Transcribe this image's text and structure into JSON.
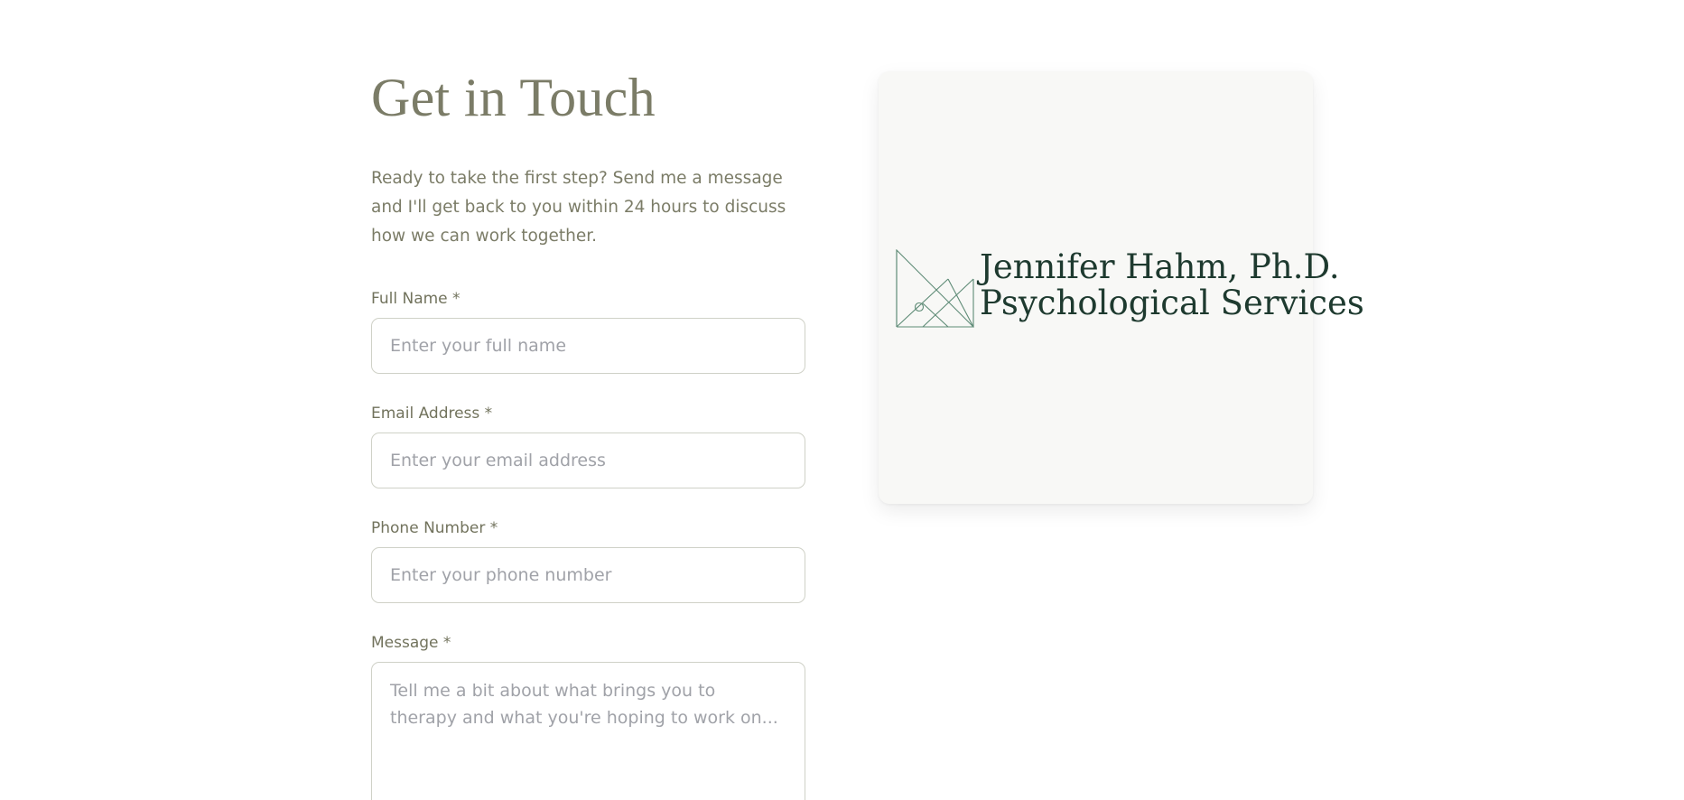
{
  "contact": {
    "title": "Get in Touch",
    "intro": "Ready to take the first step? Send me a message and I'll get back to you within 24 hours to discuss how we can work together."
  },
  "form": {
    "full_name": {
      "label": "Full Name *",
      "placeholder": "Enter your full name"
    },
    "email": {
      "label": "Email Address *",
      "placeholder": "Enter your email address"
    },
    "phone": {
      "label": "Phone Number *",
      "placeholder": "Enter your phone number"
    },
    "message": {
      "label": "Message *",
      "placeholder": "Tell me a bit about what brings you to therapy and what you're hoping to work on..."
    }
  },
  "logo": {
    "line1": "Jennifer Hahm, Ph.D.",
    "line2": "Psychological Services",
    "icon": "crown-logo-icon"
  },
  "colors": {
    "heading": "#7b7c67",
    "logo_text": "#1e3a2f",
    "logo_stroke": "#5e8b76",
    "input_border": "#cfd1c7"
  }
}
